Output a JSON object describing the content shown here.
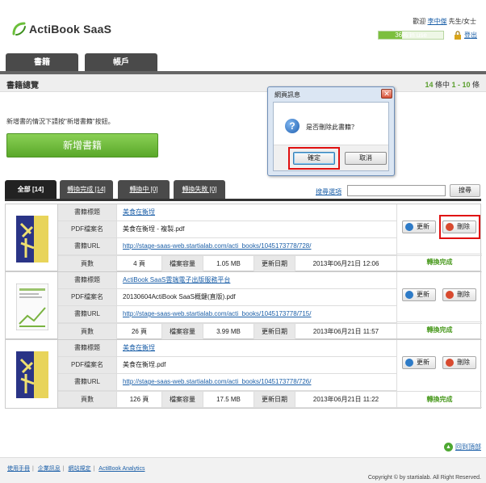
{
  "header": {
    "logo_text": "ActiBook SaaS",
    "welcome": "歡迎",
    "user_name": "李中傑",
    "honorific": "先生/女士",
    "usage_label": "36% in use",
    "usage_percent": 36,
    "logout": "登出"
  },
  "main_tabs": [
    "書籍",
    "帳戶"
  ],
  "section": {
    "title": "書籍總覽",
    "pager_total": "14",
    "pager_mid": " 條中 ",
    "pager_range": "1 - 10",
    "pager_suffix": " 條"
  },
  "hint_text": "新增書的情況下請按\"新增書籍\"按鈕。",
  "add_button": "新增書籍",
  "filter_tabs": [
    {
      "label": "全部 [14]"
    },
    {
      "label": "轉換完成 [14]"
    },
    {
      "label": "轉換中 [0]"
    },
    {
      "label": "轉換失敗 [0]"
    }
  ],
  "search": {
    "options_link": "搜尋選項",
    "value": "",
    "button": "搜尋"
  },
  "labels": {
    "title": "書籍標題",
    "pdf": "PDF檔案名",
    "url": "書籍URL",
    "pages": "頁數",
    "size": "檔案容量",
    "date": "更新日期",
    "update": "更新",
    "delete": "刪除"
  },
  "books": [
    {
      "title": "美食在衡埕",
      "pdf": "美食在衡埕 - 複製.pdf",
      "url": "http://stage-saas-web.startialab.com/acti_books/1045173778/728/",
      "pages": "4 頁",
      "size": "1.05 MB",
      "date": "2013年06月21日 12:06",
      "status": "轉換完成"
    },
    {
      "title": "ActiBook SaaS雲端電子出版服務平台",
      "pdf": "20130604ActiBook SaaS概鍵(直版).pdf",
      "url": "http://stage-saas-web.startialab.com/acti_books/1045173778/715/",
      "pages": "26 頁",
      "size": "3.99 MB",
      "date": "2013年06月21日 11:57",
      "status": "轉換完成"
    },
    {
      "title": "美食在衡埕",
      "pdf": "美食在衡埕.pdf",
      "url": "http://stage-saas-web.startialab.com/acti_books/1045173778/726/",
      "pages": "126 頁",
      "size": "17.5 MB",
      "date": "2013年06月21日 11:22",
      "status": "轉換完成"
    }
  ],
  "dialog": {
    "title": "網頁訊息",
    "message": "是否刪除此書籍？",
    "ok": "確定",
    "cancel": "取消"
  },
  "footer": {
    "back_to_top": "回到頂部",
    "links": [
      "使用手冊",
      "企業訊息",
      "網站規定",
      "ActiBook Analytics"
    ],
    "copyright": "Copyright © by startialab. All Right Reserved."
  },
  "colors": {
    "accent_green": "#5aa82a",
    "dark_tab": "#4a4a4a",
    "link_blue": "#1b5fa8",
    "highlight_red": "#e01010"
  }
}
